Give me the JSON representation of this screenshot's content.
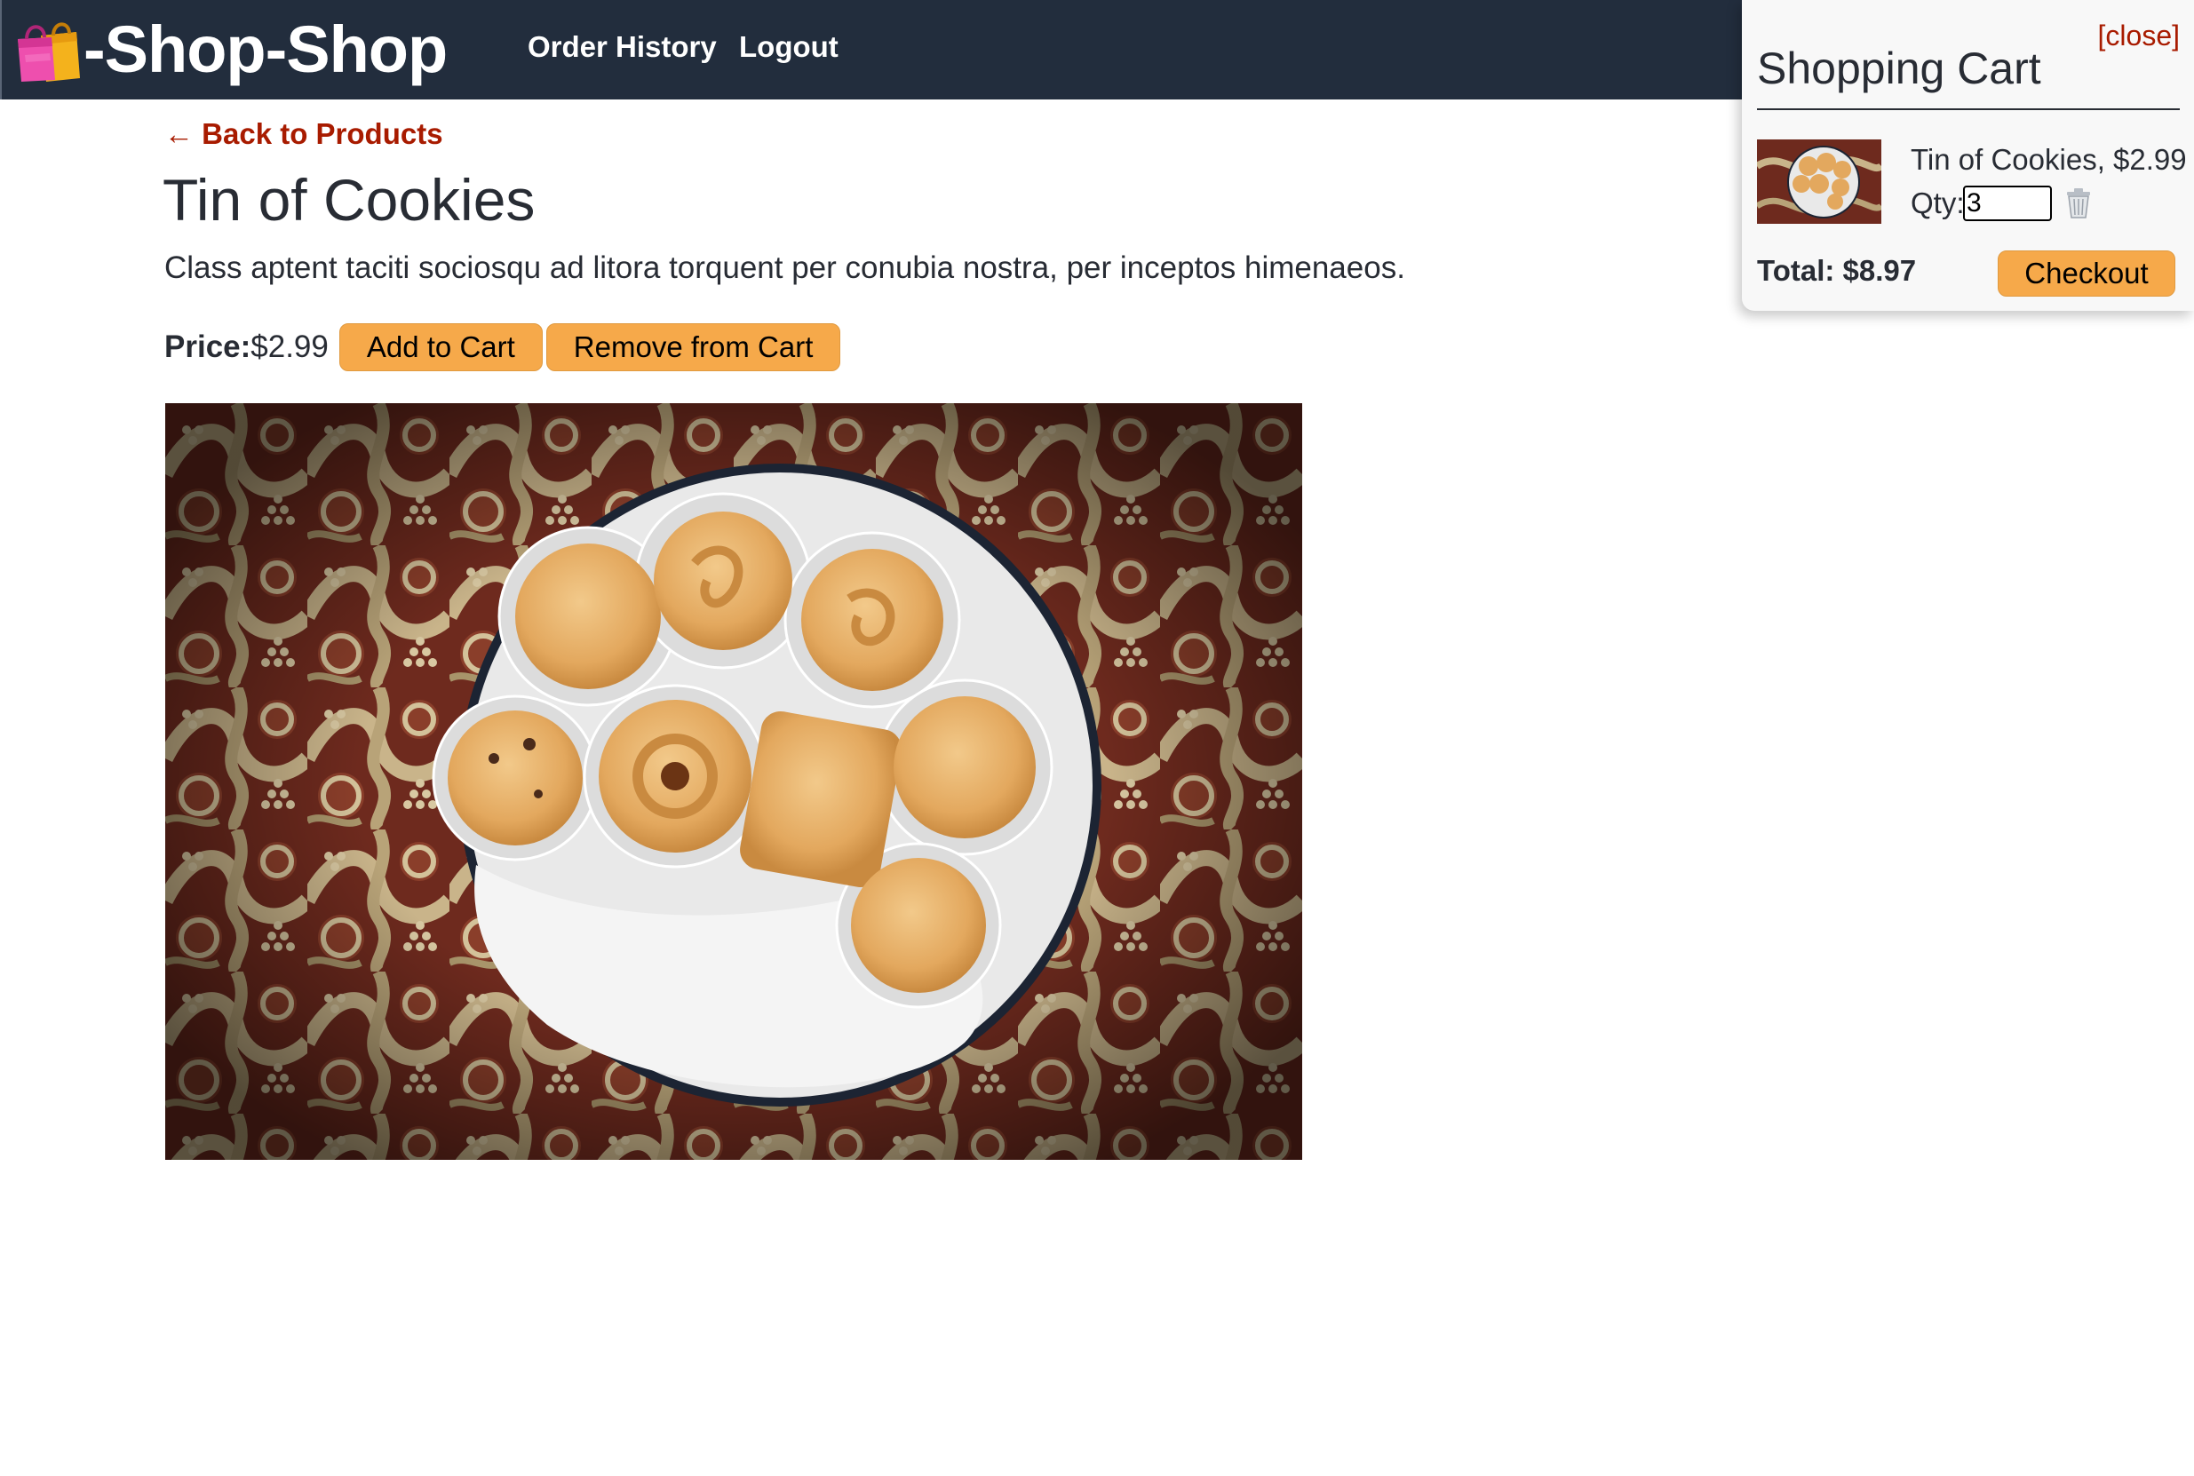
{
  "header": {
    "brand": "-Shop-Shop",
    "nav": {
      "order_history": "Order History",
      "logout": "Logout"
    }
  },
  "product": {
    "back_link": "← Back to Products",
    "name": "Tin of Cookies",
    "description": "Class aptent taciti sociosqu ad litora torquent per conubia nostra, per inceptos himenaeos.",
    "price_label": "Price:",
    "price": "$2.99",
    "add_to_cart_label": "Add to Cart",
    "remove_from_cart_label": "Remove from Cart"
  },
  "cart": {
    "close_label": "[close]",
    "title": "Shopping Cart",
    "items": [
      {
        "name_price": "Tin of Cookies, $2.99",
        "qty_label": "Qty:",
        "qty": "3"
      }
    ],
    "total": "Total: $8.97",
    "checkout_label": "Checkout"
  },
  "colors": {
    "header_bg": "#222d3d",
    "accent_button": "#f6a94a",
    "link_red": "#a81b00",
    "text_dark": "#282c34"
  },
  "icons": {
    "brand": "shopping-bags-icon",
    "delete": "trash-icon"
  }
}
